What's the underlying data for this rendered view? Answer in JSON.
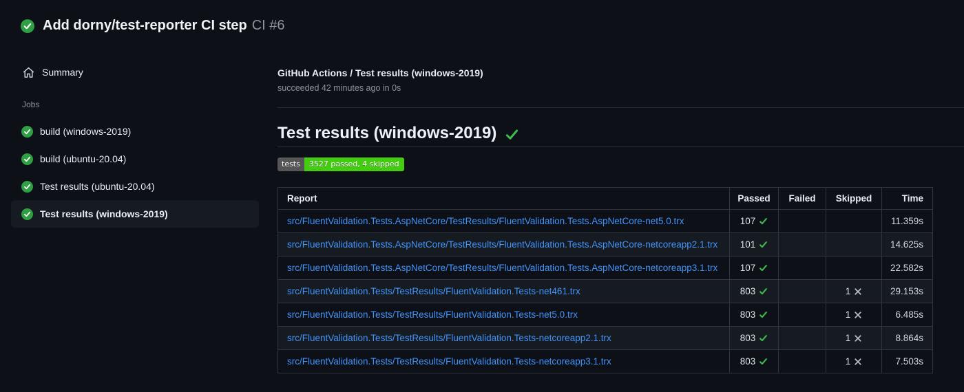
{
  "header": {
    "title": "Add dorny/test-reporter CI step",
    "run_number": "CI #6"
  },
  "sidebar": {
    "summary_label": "Summary",
    "jobs_section_label": "Jobs",
    "jobs": [
      {
        "label": "build (windows-2019)",
        "selected": false
      },
      {
        "label": "build (ubuntu-20.04)",
        "selected": false
      },
      {
        "label": "Test results (ubuntu-20.04)",
        "selected": false
      },
      {
        "label": "Test results (windows-2019)",
        "selected": true
      }
    ]
  },
  "main": {
    "breadcrumb": "GitHub Actions / Test results (windows-2019)",
    "status_line": "succeeded 42 minutes ago in 0s",
    "heading": "Test results (windows-2019)",
    "badge": {
      "label": "tests",
      "value": "3527 passed, 4 skipped",
      "label_bg": "#555555",
      "value_bg": "#44cc11"
    },
    "table": {
      "columns": [
        "Report",
        "Passed",
        "Failed",
        "Skipped",
        "Time"
      ],
      "rows": [
        {
          "report": "src/FluentValidation.Tests.AspNetCore/TestResults/FluentValidation.Tests.AspNetCore-net5.0.trx",
          "passed": "107",
          "failed": "",
          "skipped": "",
          "time": "11.359s"
        },
        {
          "report": "src/FluentValidation.Tests.AspNetCore/TestResults/FluentValidation.Tests.AspNetCore-netcoreapp2.1.trx",
          "passed": "101",
          "failed": "",
          "skipped": "",
          "time": "14.625s"
        },
        {
          "report": "src/FluentValidation.Tests.AspNetCore/TestResults/FluentValidation.Tests.AspNetCore-netcoreapp3.1.trx",
          "passed": "107",
          "failed": "",
          "skipped": "",
          "time": "22.582s"
        },
        {
          "report": "src/FluentValidation.Tests/TestResults/FluentValidation.Tests-net461.trx",
          "passed": "803",
          "failed": "",
          "skipped": "1",
          "time": "29.153s"
        },
        {
          "report": "src/FluentValidation.Tests/TestResults/FluentValidation.Tests-net5.0.trx",
          "passed": "803",
          "failed": "",
          "skipped": "1",
          "time": "6.485s"
        },
        {
          "report": "src/FluentValidation.Tests/TestResults/FluentValidation.Tests-netcoreapp2.1.trx",
          "passed": "803",
          "failed": "",
          "skipped": "1",
          "time": "8.864s"
        },
        {
          "report": "src/FluentValidation.Tests/TestResults/FluentValidation.Tests-netcoreapp3.1.trx",
          "passed": "803",
          "failed": "",
          "skipped": "1",
          "time": "7.503s"
        }
      ]
    }
  },
  "icons": {
    "run_status": "check-circle-icon",
    "summary": "home-icon",
    "job_status": "check-circle-icon",
    "heading_status": "check-icon",
    "passed_cell": "check-icon",
    "skipped_cell": "x-icon"
  },
  "colors": {
    "page_bg": "#0d1117",
    "success_circle": "#2ea043",
    "success_check": "#3fb950",
    "link_blue": "#4493f8",
    "muted_text": "#8b949e",
    "table_border": "#30363d",
    "row_alt_bg": "#161b22"
  }
}
